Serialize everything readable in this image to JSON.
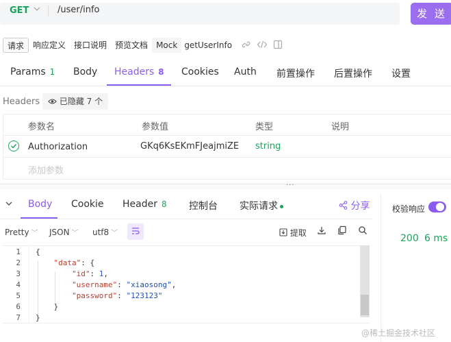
{
  "request": {
    "method": "GET",
    "url": "/user/info",
    "send_label": "发 送"
  },
  "sub_tabs": {
    "items": [
      "请求",
      "响应定义",
      "接口说明",
      "预览文档",
      "Mock"
    ],
    "name": "getUserInfo"
  },
  "main_tabs": [
    {
      "label": "Params",
      "count": "1"
    },
    {
      "label": "Body",
      "count": ""
    },
    {
      "label": "Headers",
      "count": "8"
    },
    {
      "label": "Cookies",
      "count": ""
    },
    {
      "label": "Auth",
      "count": ""
    },
    {
      "label": "前置操作",
      "count": ""
    },
    {
      "label": "后置操作",
      "count": ""
    },
    {
      "label": "设置",
      "count": ""
    }
  ],
  "headers_section": {
    "label": "Headers",
    "hidden_pill": "已隐藏 7 个"
  },
  "table": {
    "columns": [
      "参数名",
      "参数值",
      "类型",
      "说明"
    ],
    "rows": [
      {
        "name": "Authorization",
        "value": "GKq6KsEKmFJeajmiZE",
        "type": "string",
        "desc": ""
      }
    ],
    "add_placeholder": "添加参数"
  },
  "response_tabs": [
    {
      "label": "Body",
      "count": ""
    },
    {
      "label": "Cookie",
      "count": ""
    },
    {
      "label": "Header",
      "count": "8"
    },
    {
      "label": "控制台",
      "count": ""
    },
    {
      "label": "实际请求",
      "count": ""
    }
  ],
  "share_label": "分享",
  "right_panel": {
    "verify_label": "校验响应",
    "status": "200",
    "time": "6 ms"
  },
  "toolbar": {
    "format": "Pretty",
    "type": "JSON",
    "encoding": "utf8",
    "extract_label": "提取"
  },
  "code_lines": [
    {
      "n": "1",
      "text": "{"
    },
    {
      "n": "2",
      "text": "    \"data\": {"
    },
    {
      "n": "3",
      "text": "        \"id\": 1,"
    },
    {
      "n": "4",
      "text": "        \"username\": \"xiaosong\","
    },
    {
      "n": "5",
      "text": "        \"password\": \"123123\""
    },
    {
      "n": "6",
      "text": "    }"
    },
    {
      "n": "7",
      "text": "}"
    }
  ],
  "watermark": "@稀土掘金技术社区",
  "colors": {
    "accent": "#8a5cf0",
    "method_green": "#17a45a",
    "send_button": "#9b6ef0"
  },
  "icons": [
    "chevron-down-icon",
    "link-icon",
    "code-icon",
    "panel-icon",
    "eye-icon",
    "check-circle-icon",
    "share-icon",
    "import-icon",
    "download-icon",
    "copy-icon",
    "search-icon",
    "wrap-icon"
  ]
}
